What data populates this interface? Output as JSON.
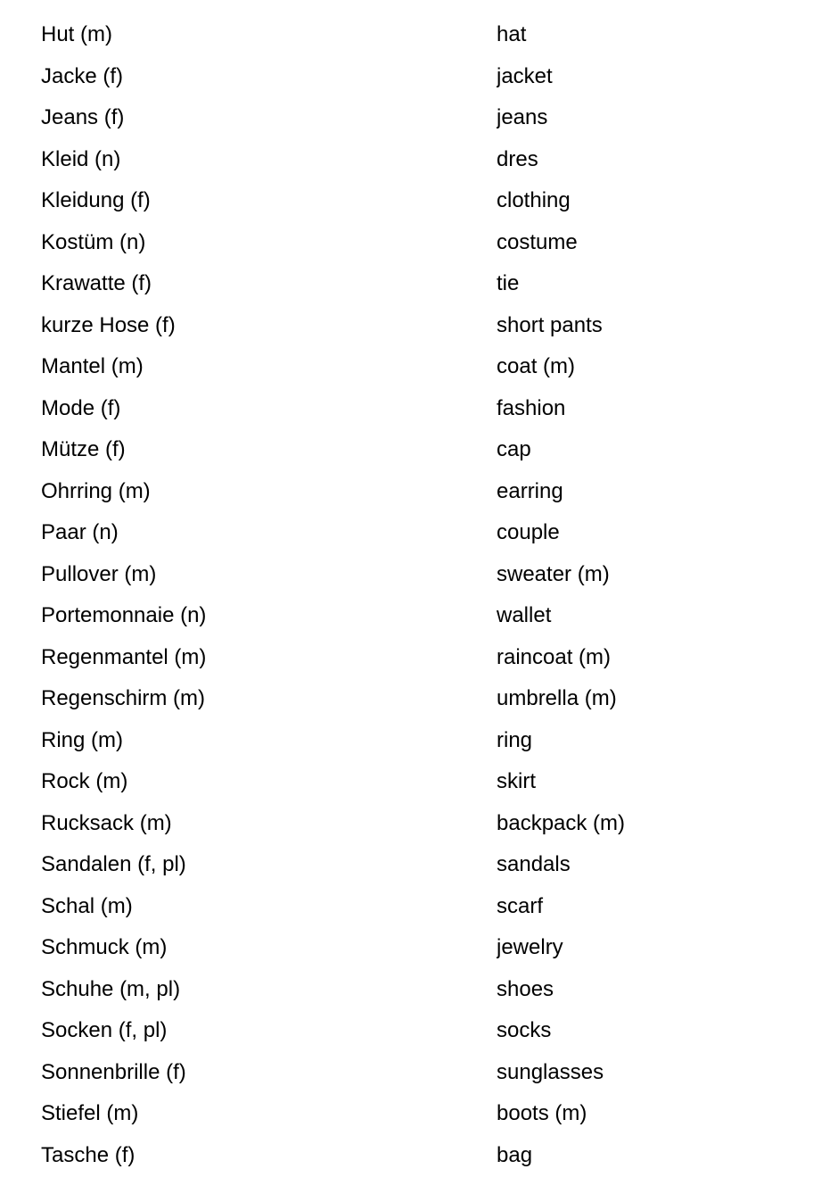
{
  "document": {
    "type": "vocabulary-list",
    "language_pair": "German-English",
    "background_color": "#ffffff",
    "text_color": "#000000",
    "columns": {
      "term_language": "German",
      "translation_language": "English"
    }
  },
  "rows": [
    {
      "term": "Hut (m)",
      "translation": "hat"
    },
    {
      "term": "Jacke (f)",
      "translation": "jacket"
    },
    {
      "term": "Jeans (f)",
      "translation": "jeans"
    },
    {
      "term": "Kleid (n)",
      "translation": "dres"
    },
    {
      "term": "Kleidung (f)",
      "translation": "clothing"
    },
    {
      "term": "Kostüm (n)",
      "translation": "costume"
    },
    {
      "term": "Krawatte (f)",
      "translation": "tie"
    },
    {
      "term": "kurze Hose (f)",
      "translation": "short pants"
    },
    {
      "term": "Mantel (m)",
      "translation": "coat (m)"
    },
    {
      "term": "Mode (f)",
      "translation": "fashion"
    },
    {
      "term": "Mütze (f)",
      "translation": "cap"
    },
    {
      "term": "Ohrring (m)",
      "translation": "earring"
    },
    {
      "term": "Paar (n)",
      "translation": "couple"
    },
    {
      "term": "Pullover (m)",
      "translation": "sweater (m)"
    },
    {
      "term": "Portemonnaie (n)",
      "translation": "wallet"
    },
    {
      "term": "Regenmantel (m)",
      "translation": "raincoat (m)"
    },
    {
      "term": "Regenschirm (m)",
      "translation": "umbrella (m)"
    },
    {
      "term": "Ring (m)",
      "translation": "ring"
    },
    {
      "term": "Rock (m)",
      "translation": "skirt"
    },
    {
      "term": "Rucksack (m)",
      "translation": "backpack (m)"
    },
    {
      "term": "Sandalen (f, pl)",
      "translation": "sandals"
    },
    {
      "term": "Schal (m)",
      "translation": "scarf"
    },
    {
      "term": "Schmuck (m)",
      "translation": "jewelry"
    },
    {
      "term": "Schuhe (m, pl)",
      "translation": "shoes"
    },
    {
      "term": "Socken (f, pl)",
      "translation": "socks"
    },
    {
      "term": "Sonnenbrille (f)",
      "translation": "sunglasses"
    },
    {
      "term": "Stiefel (m)",
      "translation": "boots (m)"
    },
    {
      "term": "Tasche (f)",
      "translation": "bag"
    }
  ]
}
